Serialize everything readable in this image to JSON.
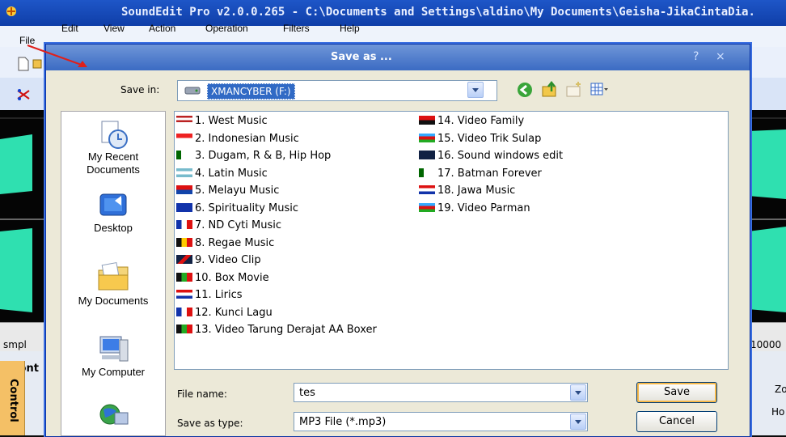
{
  "app": {
    "title": "SoundEdit Pro v2.0.0.265 - C:\\Documents and Settings\\aldino\\My Documents\\Geisha-JikaCintaDia."
  },
  "menu": [
    "File",
    "Edit",
    "View",
    "Action",
    "Operation",
    "Filters",
    "Help"
  ],
  "ruler": {
    "left_label": "smpl",
    "right_label": "10000"
  },
  "bottom_panel": {
    "tab_label": "Cont",
    "vertical_tab": "Control",
    "right_label_1": "Zo",
    "right_label_2": "Ho"
  },
  "dialog": {
    "title": "Save as ...",
    "help_glyph": "?",
    "close_glyph": "×",
    "save_in_label": "Save in:",
    "save_in_value": "XMANCYBER (F:)",
    "places": [
      {
        "label": "My Recent\nDocuments",
        "icon": "recent-documents-icon"
      },
      {
        "label": "Desktop",
        "icon": "desktop-icon"
      },
      {
        "label": "My Documents",
        "icon": "my-documents-icon"
      },
      {
        "label": "My Computer",
        "icon": "my-computer-icon"
      },
      {
        "label": "",
        "icon": "network-icon"
      }
    ],
    "files_left": [
      "1. West  Music",
      "2. Indonesian Music",
      "3. Dugam, R & B, Hip Hop",
      "4. Latin  Music",
      "5. Melayu Music",
      "6. Spirituality Music",
      "7. ND Cyti Music",
      "8. Regae Music",
      "9. Video Clip",
      "10. Box Movie",
      "11. Lirics",
      "12.  Kunci Lagu",
      "13. Video Tarung Derajat AA Boxer"
    ],
    "files_right": [
      "14. Video Family",
      "15. Video Trik Sulap",
      "16. Sound windows edit",
      "17. Batman Forever",
      "18. Jawa Music",
      "19. Video Parman"
    ],
    "file_name_label": "File name:",
    "file_name_value": "tes",
    "save_type_label": "Save as type:",
    "save_type_value": "MP3 File (*.mp3)",
    "save_button": "Save",
    "cancel_button": "Cancel"
  },
  "colors": {
    "title_bar": "#1e56c8",
    "dialog_title": "#4d7bcc",
    "waveform": "#2fe0b0",
    "selection": "#316ac5",
    "annotation_arrow": "#e0201a"
  }
}
